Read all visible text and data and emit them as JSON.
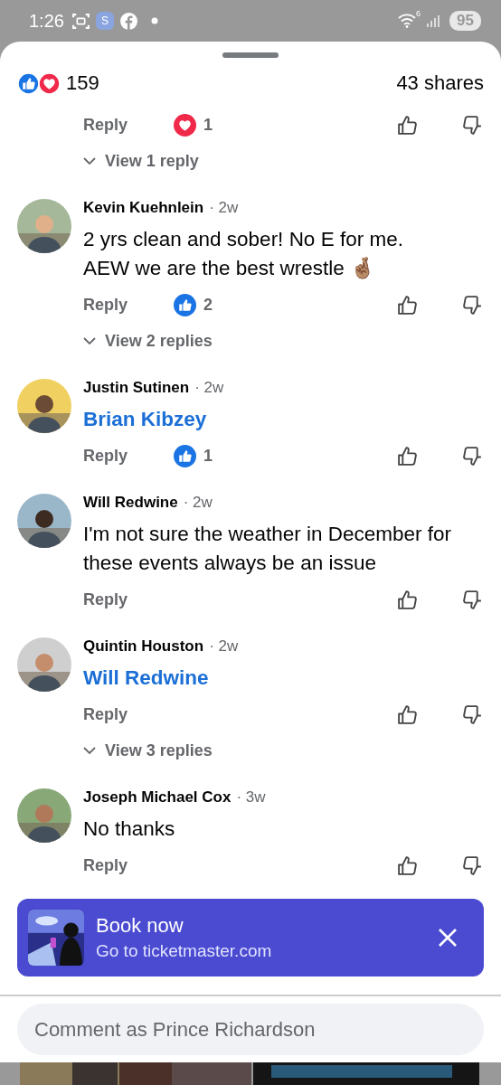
{
  "status_bar": {
    "time": "1:26",
    "app_badge": "S",
    "wifi_label": "6",
    "battery": "95"
  },
  "summary": {
    "reactions": [
      {
        "kind": "like"
      },
      {
        "kind": "love"
      }
    ],
    "count": "159",
    "shares": "43 shares"
  },
  "comments": [
    {
      "reply": "Reply",
      "reaction": {
        "kind": "love",
        "count": "1"
      },
      "view_replies": "View 1 reply"
    },
    {
      "author": "Kevin Kuehnlein",
      "time": "· 2w",
      "kind": "text",
      "body": [
        "2 yrs clean and sober! No E for me.",
        "AEW we are the best wrestle 🤞🏽"
      ],
      "reply": "Reply",
      "reaction": {
        "kind": "like",
        "count": "2"
      },
      "view_replies": "View 2 replies"
    },
    {
      "author": "Justin Sutinen",
      "time": "· 2w",
      "kind": "mention",
      "body": "Brian Kibzey",
      "reply": "Reply",
      "reaction": {
        "kind": "like",
        "count": "1"
      }
    },
    {
      "author": "Will Redwine",
      "time": "· 2w",
      "kind": "text",
      "body": [
        "I'm not sure the weather in December for",
        "these events always be an issue"
      ],
      "reply": "Reply"
    },
    {
      "author": "Quintin Houston",
      "time": "· 2w",
      "kind": "mention",
      "body": "Will Redwine",
      "reply": "Reply",
      "view_replies": "View 3 replies"
    },
    {
      "author": "Joseph Michael Cox",
      "time": "· 3w",
      "kind": "text",
      "body": [
        "No thanks"
      ],
      "reply": "Reply"
    }
  ],
  "banner": {
    "title": "Book now",
    "subtitle": "Go to ticketmaster.com"
  },
  "composer": {
    "placeholder": "Comment as Prince Richardson"
  }
}
